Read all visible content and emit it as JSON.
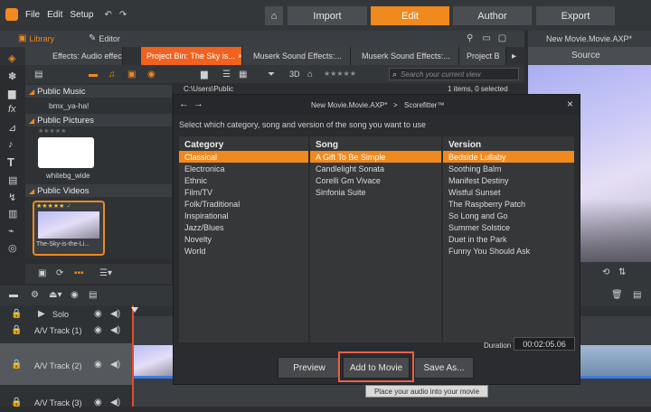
{
  "menu": {
    "file": "File",
    "edit": "Edit",
    "setup": "Setup"
  },
  "modes": {
    "import": "Import",
    "edit": "Edit",
    "author": "Author",
    "export": "Export"
  },
  "library": {
    "library_label": "Library",
    "editor_label": "Editor"
  },
  "project_title": "New Movie.Movie.AXP*",
  "tabs": [
    "Effects: Audio effects",
    "Project Bin: The Sky is...",
    "Muserk Sound Effects:...",
    "Muserk Sound Effects:...",
    "Project B"
  ],
  "tab_close": "×",
  "search_placeholder": "Search your current view",
  "rating_label": "3D",
  "path": "C:\\Users\\Public",
  "item_count": "1 items, 0 selected",
  "tree": {
    "public_music": "Public Music",
    "music_item": "bmx_ya-ha!",
    "public_pictures": "Public Pictures",
    "picture_item": "whitebg_wide",
    "public_videos": "Public Videos",
    "video_item": "The-Sky-is-the-Li..."
  },
  "preview": {
    "title": "New Movie.Movie.AXP*",
    "source": "Source"
  },
  "timeline": {
    "solo": "Solo",
    "tracks": [
      "A/V Track (1)",
      "A/V Track (2)",
      "A/V Track (3)"
    ]
  },
  "dialog": {
    "breadcrumb_1": "New Movie.Movie.AXP*",
    "breadcrumb_sep": ">",
    "breadcrumb_2": "Scorefitter™",
    "instruction": "Select which category, song and version of the song you want to use",
    "category_header": "Category",
    "song_header": "Song",
    "version_header": "Version",
    "categories": [
      "Classical",
      "Electronica",
      "Ethnic",
      "Film/TV",
      "Folk/Traditional",
      "Inspirational",
      "Jazz/Blues",
      "Novelty",
      "World"
    ],
    "songs": [
      "A Gift To Be Simple",
      "Candlelight Sonata",
      "Corelli Gm Vivace",
      "Sinfonia Suite"
    ],
    "versions": [
      "Bedside Lullaby",
      "Soothing Balm",
      "Manifest Destiny",
      "Wistful Sunset",
      "The Raspberry Patch",
      "So Long and Go",
      "Summer Solstice",
      "Duet in the Park",
      "Funny You Should Ask"
    ],
    "duration_label": "Duration",
    "duration_value": "00:02:05.06",
    "preview_btn": "Preview",
    "add_btn": "Add to Movie",
    "save_btn": "Save As...",
    "tooltip": "Place your audio into your movie",
    "close": "×"
  },
  "colors": {
    "accent": "#f0891e",
    "active_tab": "#f0621e",
    "highlight_border": "#e8604c"
  }
}
